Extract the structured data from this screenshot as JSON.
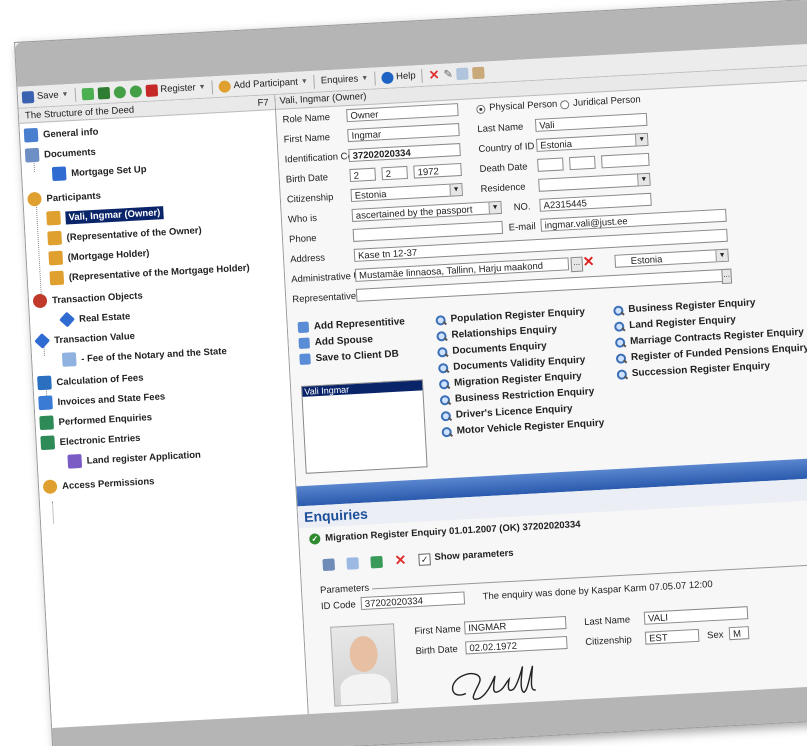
{
  "toolbar": {
    "save_label": "Save",
    "register_label": "Register",
    "add_participant_label": "Add Participant",
    "enquiries_label": "Enquires",
    "help_label": "Help"
  },
  "left_panel": {
    "title": "The Structure of the Deed",
    "shortcut": "F7",
    "items": [
      {
        "label": "General info"
      },
      {
        "label": "Documents"
      },
      {
        "label": "Mortgage Set Up"
      },
      {
        "label": "Participants"
      },
      {
        "label": "Vali, Ingmar (Owner)"
      },
      {
        "label": "(Representative of the Owner)"
      },
      {
        "label": "(Mortgage Holder)"
      },
      {
        "label": "(Representative of the Mortgage Holder)"
      },
      {
        "label": "Transaction Objects"
      },
      {
        "label": "Real Estate"
      },
      {
        "label": "Transaction Value"
      },
      {
        "label": "- Fee of the Notary and the State"
      },
      {
        "label": "Calculation of Fees"
      },
      {
        "label": "Invoices and State Fees"
      },
      {
        "label": "Performed Enquiries"
      },
      {
        "label": "Electronic Entries"
      },
      {
        "label": "Land register Application"
      },
      {
        "label": "Access Permissions"
      }
    ]
  },
  "form": {
    "header": "Vali, Ingmar (Owner)",
    "role_name_label": "Role Name",
    "role_name_value": "Owner",
    "physical_person": "Physical Person",
    "juridical_person": "Juridical Person",
    "first_name_label": "First Name",
    "first_name_value": "Ingmar",
    "last_name_label": "Last Name",
    "last_name_value": "Vali",
    "id_code_label": "Identification Code",
    "id_code_value": "37202020334",
    "country_of_id_label": "Country of ID",
    "country_of_id_value": "Estonia",
    "birth_date_label": "Birth Date",
    "birth_day": "2",
    "birth_month": "2",
    "birth_year": "1972",
    "death_date_label": "Death Date",
    "citizenship_label": "Citizenship",
    "citizenship_value": "Estonia",
    "residence_label": "Residence",
    "who_is_label": "Who is",
    "who_is_value": "ascertained by the passport",
    "no_label": "NO.",
    "no_value": "A2315445",
    "phone_label": "Phone",
    "email_label": "E-mail",
    "email_value": "ingmar.vali@just.ee",
    "address_label": "Address",
    "address_value": "Kase tn 12-37",
    "admin_unit_label": "Administrative Unit",
    "admin_unit_value": "Mustamäe linnaosa, Tallinn, Harju maakond",
    "admin_country_value": "Estonia",
    "representative_label": "Representative"
  },
  "actions": {
    "add_representative": "Add Representitive",
    "add_spouse": "Add Spouse",
    "save_to_client_db": "Save to Client DB",
    "list_item": "Vali Ingmar"
  },
  "enquiry_links": {
    "col1": [
      "Population Register Enquiry",
      "Relationships Enquiry",
      "Documents Enquiry",
      "Documents Validity Enquiry",
      "Migration Register Enquiry",
      "Business Restriction Enquiry",
      "Driver's Licence Enquiry",
      "Motor Vehicle Register Enquiry"
    ],
    "col2": [
      "Business Register Enquiry",
      "Land Register Enquiry",
      "Marriage Contracts Register Enquiry",
      "Register of Funded Pensions Enquiry",
      "Succession Register Enquiry"
    ]
  },
  "enquiries": {
    "title": "Enquiries",
    "collapse_glyph": "«",
    "result_title": "Migration Register Enquiry 01.01.2007 (OK) 37202020334",
    "show_parameters": "Show parameters",
    "parameters_label": "Parameters",
    "id_code_label": "ID Code",
    "id_code_value": "37202020334",
    "done_by": "The enquiry was done by Kaspar Karm 07.05.07 12:00",
    "first_name_label": "First Name",
    "first_name_value": "INGMAR",
    "last_name_label": "Last Name",
    "last_name_value": "VALI",
    "birth_date_label": "Birth Date",
    "birth_date_value": "02.02.1972",
    "citizenship_label": "Citizenship",
    "citizenship_value": "EST",
    "sex_label": "Sex",
    "sex_value": "M"
  }
}
